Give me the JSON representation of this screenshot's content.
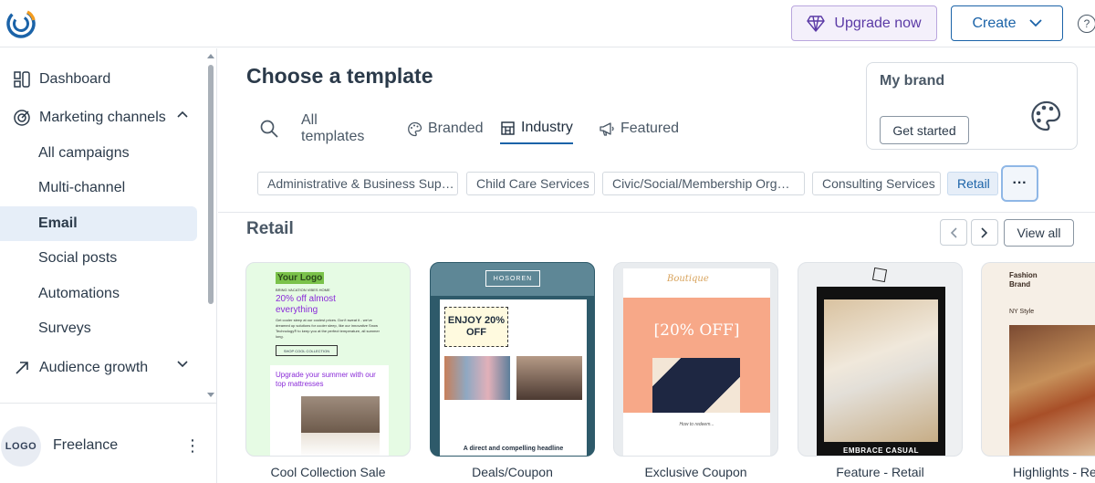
{
  "header": {
    "upgrade_label": "Upgrade now",
    "create_label": "Create",
    "help_glyph": "?"
  },
  "sidebar": {
    "items": [
      {
        "label": "Dashboard",
        "icon": "dashboard-icon"
      },
      {
        "label": "Marketing channels",
        "icon": "target-icon"
      },
      {
        "label": "All campaigns"
      },
      {
        "label": "Multi-channel"
      },
      {
        "label": "Email"
      },
      {
        "label": "Social posts"
      },
      {
        "label": "Automations"
      },
      {
        "label": "Surveys"
      },
      {
        "label": "Audience growth",
        "icon": "trend-up-icon"
      }
    ],
    "active_item": "Email",
    "account": {
      "avatar_text": "LOGO",
      "name": "Freelance"
    }
  },
  "main": {
    "title": "Choose a template",
    "tabs": [
      {
        "label": "All templates"
      },
      {
        "label": "Branded",
        "icon": "palette-icon"
      },
      {
        "label": "Industry",
        "icon": "building-icon"
      },
      {
        "label": "Featured",
        "icon": "megaphone-icon"
      }
    ],
    "active_tab": "Industry",
    "brand_card": {
      "title": "My brand",
      "button_label": "Get started"
    },
    "chips": [
      "Administrative & Business Sup…",
      "Child Care Services",
      "Civic/Social/Membership Org…",
      "Consulting Services",
      "Retail"
    ],
    "active_chip": "Retail",
    "more_label": "···",
    "section": {
      "title": "Retail",
      "view_all_label": "View all",
      "prev_glyph": "‹",
      "next_glyph": "›"
    },
    "templates": [
      {
        "label": "Cool Collection Sale",
        "preview": {
          "logo": "Your Logo",
          "kicker": "BRING VACATION VIBES HOME",
          "headline": "20% off almost everything",
          "body": "Get cooler sleep at our coolest prices. Don't sweat it - we've dreamed up solutions for cooler sleep, like our innovative Snow Technology® to keep you at the perfect temperature, all summer long.",
          "button": "SHOP COOL COLLECTION",
          "subhead": "Upgrade your summer with our top mattresses"
        }
      },
      {
        "label": "Deals/Coupon",
        "preview": {
          "brand": "HOSOREN",
          "promo": "ENJOY 20% OFF",
          "headline": "A direct and compelling headline"
        }
      },
      {
        "label": "Exclusive Coupon",
        "preview": {
          "brand": "Boutique",
          "offer": "[20% OFF]",
          "how": "How to redeem..."
        }
      },
      {
        "label": "Feature - Retail",
        "preview": {
          "tagline": "EMBRACE CASUAL"
        }
      },
      {
        "label": "Highlights - Re",
        "preview": {
          "brand": "Fashion Brand",
          "style": "NY Style"
        }
      }
    ]
  },
  "colors": {
    "accent_blue": "#1b63a8",
    "upgrade_purple": "#5b3aa6",
    "active_bg": "#e6eef8"
  }
}
